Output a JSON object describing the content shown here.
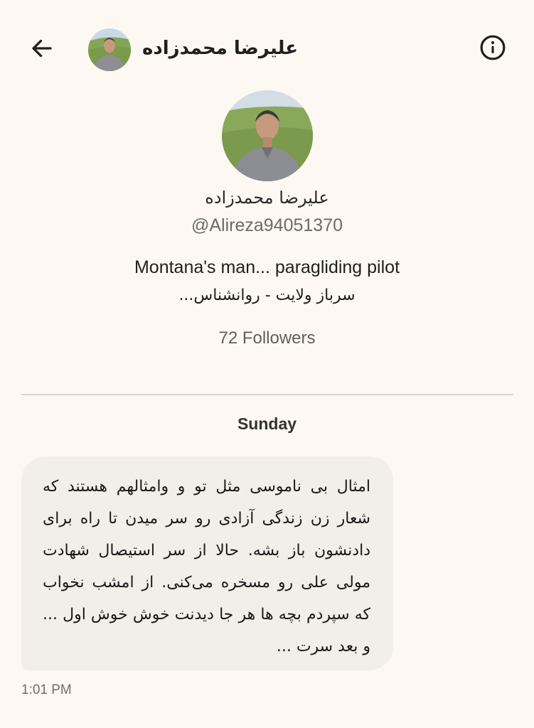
{
  "header": {
    "back_icon": "arrow-left-icon",
    "name": "علیرضا محمدزاده",
    "info_icon": "info-circle-icon"
  },
  "profile": {
    "name": "علیرضا محمدزاده",
    "handle": "@Alireza94051370",
    "bio_line_1": "Montana's man... paragliding pilot",
    "bio_line_2": "سرباز ولایت - روانشناس...",
    "followers": "72 Followers"
  },
  "conversation": {
    "day_label": "Sunday",
    "messages": [
      {
        "text": "امثال بی ناموسی مثل تو  و وامثالهم هستند که شعار زن زندگی آزادی رو سر میدن  تا راه برای دادنشون باز بشه. حالا از سر استیصال شهادت مولی علی رو مسخره می‌کنی. از امشب نخواب که سپردم بچه ها هر جا دیدنت خوش خوش اول ... و بعد سرت ...",
        "time": "1:01 PM"
      }
    ]
  },
  "colors": {
    "background": "#fdf8f1",
    "bubble": "#f2eee8",
    "divider": "#d8d4ce",
    "secondary_text": "#6a6a6a"
  }
}
